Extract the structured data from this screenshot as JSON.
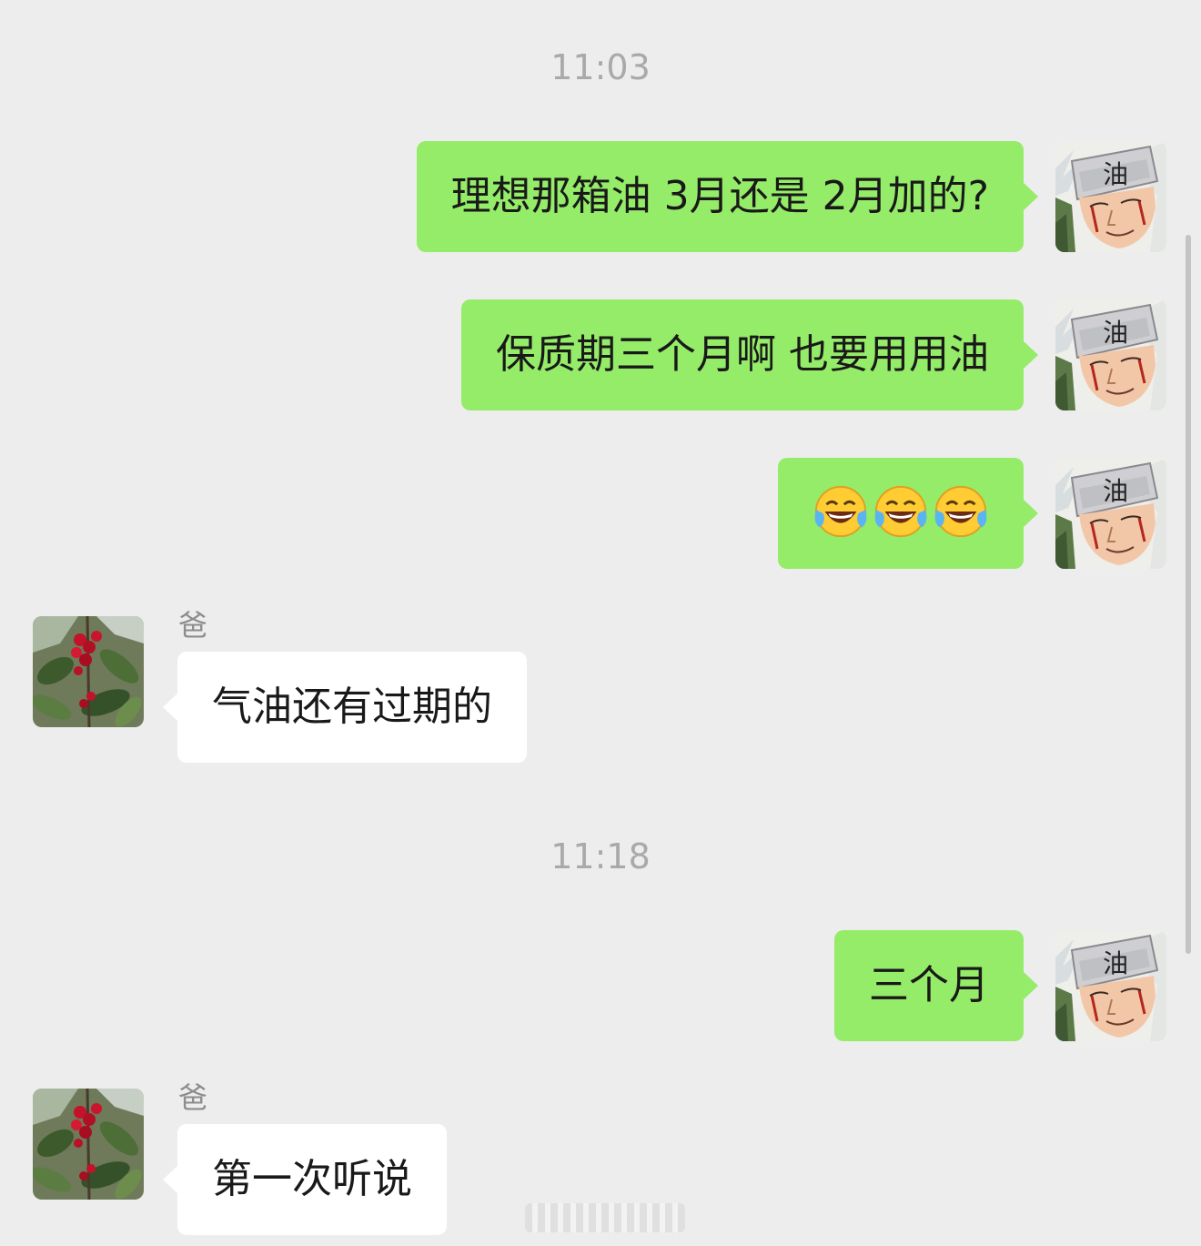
{
  "timestamps": [
    "11:03",
    "11:18"
  ],
  "contact": {
    "name": "爸"
  },
  "messages": [
    {
      "from": "me",
      "text": "理想那箱油 3月还是 2月加的?"
    },
    {
      "from": "me",
      "text": "保质期三个月啊 也要用用油"
    },
    {
      "from": "me",
      "emoji": "face-with-tears-of-joy",
      "emoji_count": 3
    },
    {
      "from": "contact",
      "sender": "爸",
      "text": "气油还有过期的"
    },
    {
      "from": "me",
      "text": "三个月"
    },
    {
      "from": "contact",
      "sender": "爸",
      "text": "第一次听说"
    }
  ],
  "colors": {
    "background": "#ededed",
    "outgoing_bubble": "#95ec69",
    "incoming_bubble": "#ffffff",
    "timestamp_text": "#a9a9a9",
    "sender_text": "#8c8c8c"
  },
  "icons": {
    "my_avatar": "anime-character-avatar",
    "contact_avatar": "cherry-tree-avatar"
  }
}
